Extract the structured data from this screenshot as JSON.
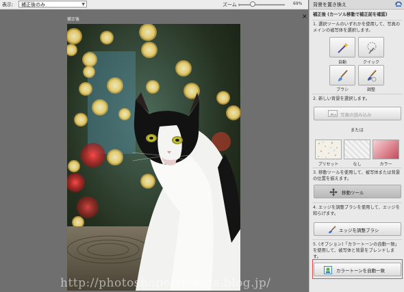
{
  "toolbar": {
    "view_label": "表示:",
    "view_value": "補正後のみ",
    "zoom_label": "ズーム :",
    "zoom_value": "69%"
  },
  "document": {
    "tab_label": "補正後"
  },
  "panel": {
    "title": "背景を置き換え",
    "subtitle": "補正後 (カーソル移動で補正前を確認)",
    "step1": "1. 選択ツールのいずれかを使用して、写真のメインの被写体を選択します。",
    "tools": [
      {
        "label": "自動",
        "icon": "magic-wand-icon"
      },
      {
        "label": "クイック",
        "icon": "quick-select-icon"
      },
      {
        "label": "ブラシ",
        "icon": "brush-icon"
      },
      {
        "label": "調整",
        "icon": "refine-brush-icon"
      }
    ],
    "step2": "2. 新しい背景を選択します。",
    "import_button": "写真の読み込み",
    "or_label": "または",
    "backgrounds": [
      {
        "label": "プリセット"
      },
      {
        "label": "なし"
      },
      {
        "label": "カラー"
      }
    ],
    "step3": "3. 移動ツールを使用して、被写体または背景の位置を揃えます。",
    "move_button": "移動ツール",
    "step4": "4. エッジを調整ブラシを使用して、エッジを和らげます。",
    "refine_button": "エッジを調整ブラシ",
    "step5": "5. (オプション)「カラートーンの自動一致」を使用して、被写体と背景をブレンドします。",
    "auto_tone_button": "カラートーンを自動一致"
  },
  "watermark": "http://photoshopelements.blog.jp/",
  "colors": {
    "panel_bg": "#e9e9e9",
    "canvas_bg": "#6f6f6f",
    "highlight": "#e04a4a"
  }
}
